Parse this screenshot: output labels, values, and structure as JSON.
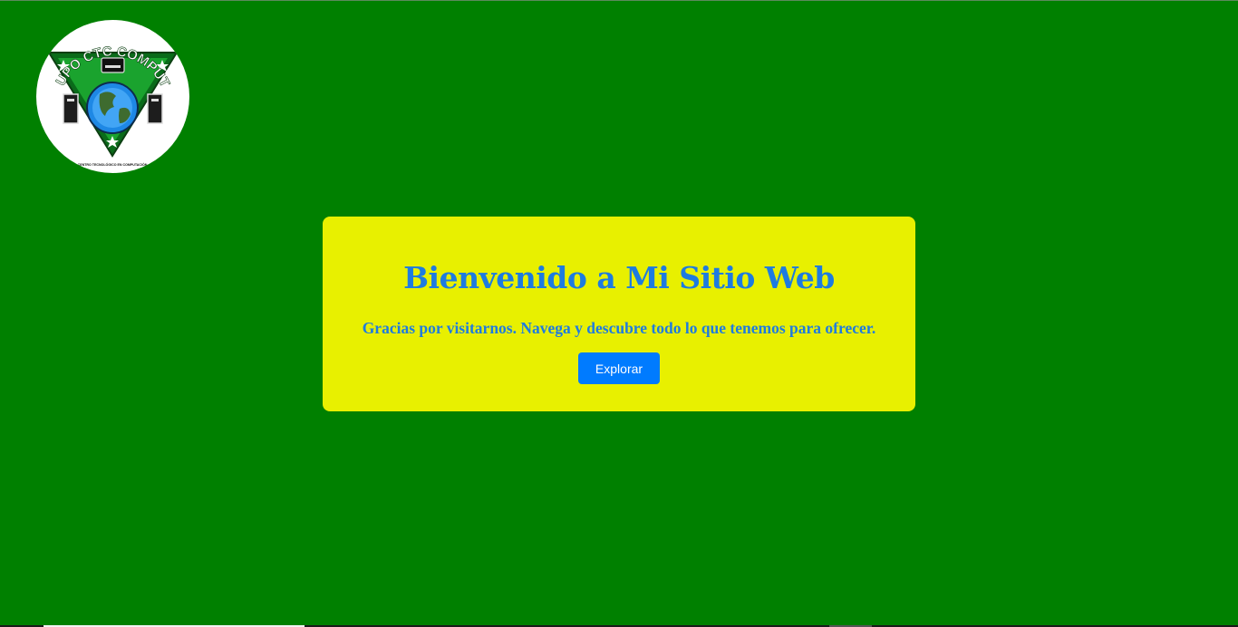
{
  "colors": {
    "background": "#008000",
    "card_background": "#e8f000",
    "heading": "#1e7be0",
    "button_background": "#007bff",
    "button_text": "#ffffff"
  },
  "logo": {
    "icon": "globe-emblem-icon",
    "top_text": "GRUPO CTC COMPUTER",
    "bottom_text": "CENTRO TECNOLÓGICO EN COMPUTACIÓN"
  },
  "hero": {
    "title": "Bienvenido a Mi Sitio Web",
    "subtitle": "Gracias por visitarnos. Navega y descubre todo lo que tenemos para ofrecer.",
    "button_label": "Explorar"
  }
}
